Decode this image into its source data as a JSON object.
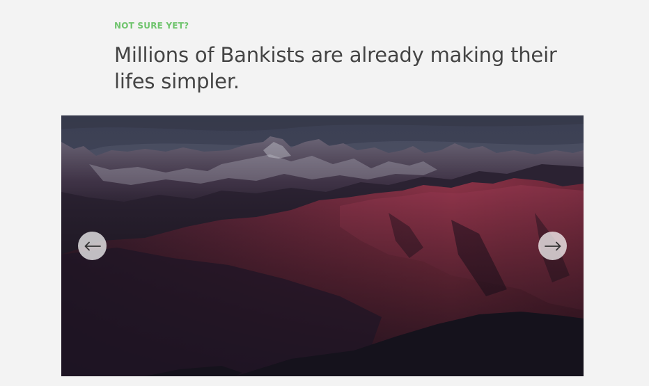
{
  "section": {
    "eyebrow": "NOT SURE YET?",
    "title": "Millions of Bankists are already making their lifes simpler."
  },
  "slider": {
    "image": "mountain-range-at-dusk",
    "prev_icon": "arrow-left-icon",
    "next_icon": "arrow-right-icon"
  },
  "colors": {
    "accent": "#6fc46d",
    "heading": "#444444",
    "background": "#f3f3f3"
  }
}
